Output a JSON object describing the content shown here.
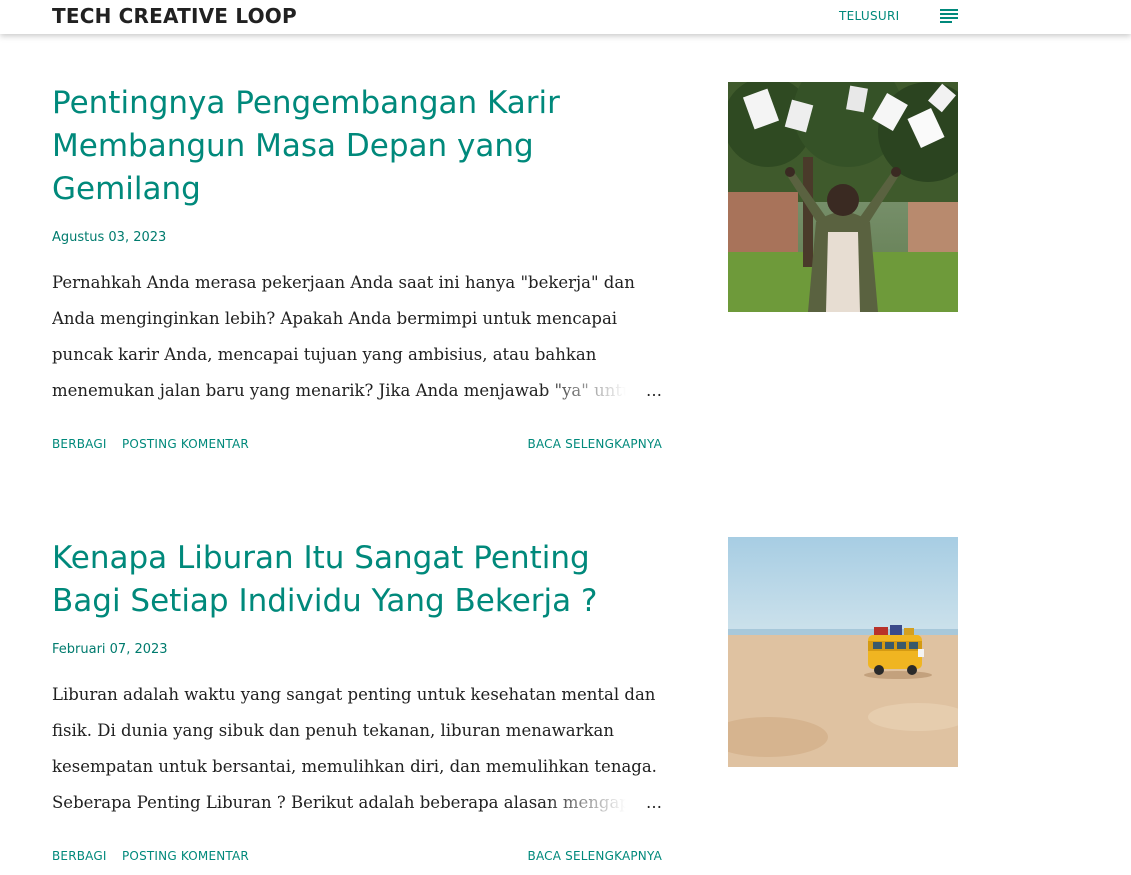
{
  "header": {
    "site_title": "TECH CREATIVE LOOP",
    "search_label": "TELUSURI",
    "menu_icon": "hamburger-menu-icon"
  },
  "colors": {
    "accent": "#00897b",
    "text": "#212121",
    "background": "#ffffff"
  },
  "posts": [
    {
      "title": "Pentingnya Pengembangan Karir Membangun Masa Depan yang Gemilang",
      "date": "Agustus 03, 2023",
      "snippet": "Pernahkah Anda merasa pekerjaan Anda saat ini hanya \"bekerja\" dan Anda menginginkan lebih? Apakah Anda bermimpi untuk mencapai puncak karir Anda, mencapai tujuan yang ambisius, atau bahkan menemukan jalan baru yang menarik? Jika Anda menjawab \"ya\" untuk",
      "ellipsis": "…",
      "share_label": "BERBAGI",
      "comment_label": "POSTING KOMENTAR",
      "read_more_label": "BACA SELENGKAPNYA",
      "image": "man-celebrating-papers-photo"
    },
    {
      "title": "Kenapa Liburan Itu Sangat Penting Bagi Setiap Individu Yang Bekerja ?",
      "date": "Februari 07, 2023",
      "snippet": "Liburan adalah waktu yang sangat penting untuk kesehatan mental dan fisik. Di dunia yang sibuk dan penuh tekanan, liburan menawarkan kesempatan untuk bersantai, memulihkan diri, dan memulihkan tenaga. Seberapa Penting Liburan ? Berikut adalah beberapa alasan mengapa",
      "ellipsis": "…",
      "share_label": "BERBAGI",
      "comment_label": "POSTING KOMENTAR",
      "read_more_label": "BACA SELENGKAPNYA",
      "image": "toy-bus-on-beach-photo"
    }
  ]
}
